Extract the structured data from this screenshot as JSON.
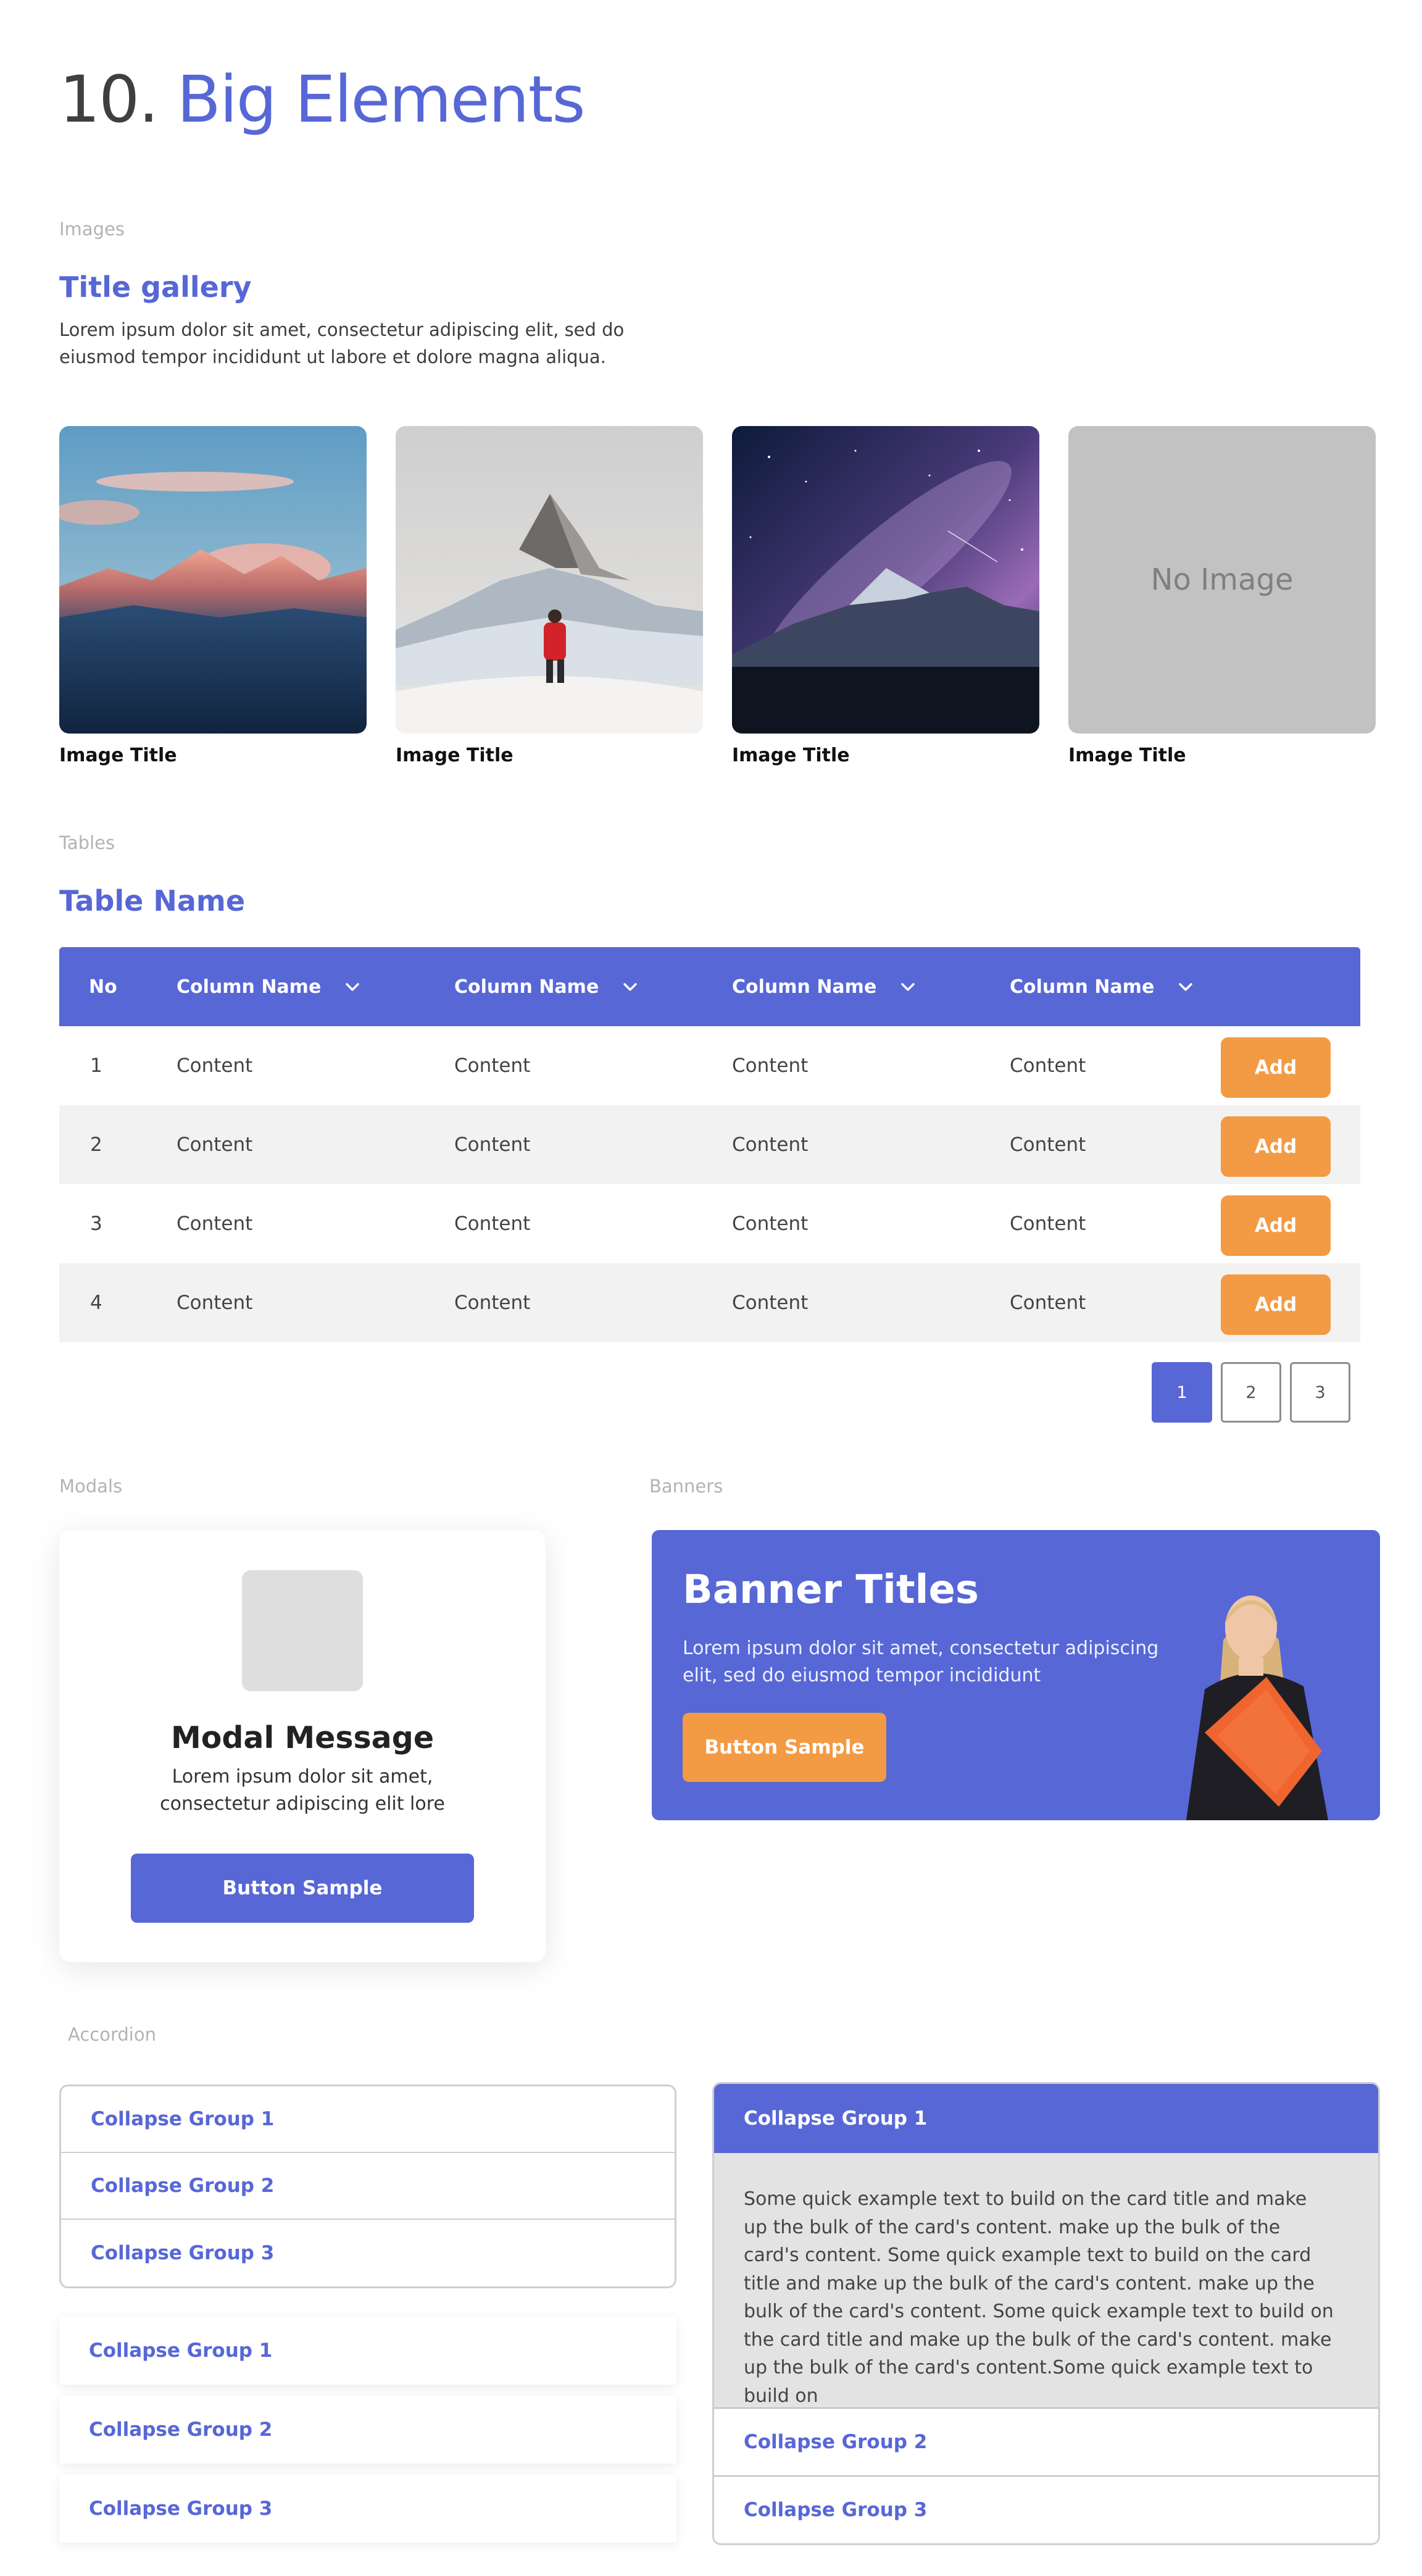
{
  "page": {
    "number": "10.",
    "title": "Big Elements"
  },
  "images": {
    "section_label": "Images",
    "title": "Title gallery",
    "description_line1": "Lorem ipsum dolor sit amet, consectetur adipiscing elit, sed do",
    "description_line2": "eiusmod tempor incididunt ut labore et dolore magna aliqua.",
    "items": [
      {
        "caption": "Image Title"
      },
      {
        "caption": "Image Title"
      },
      {
        "caption": "Image Title"
      },
      {
        "caption": "Image Title",
        "placeholder": "No Image"
      }
    ]
  },
  "tables": {
    "section_label": "Tables",
    "title": "Table Name",
    "headers": [
      "No",
      "Column Name",
      "Column Name",
      "Column Name",
      "Column Name"
    ],
    "rows": [
      {
        "no": "1",
        "cells": [
          "Content",
          "Content",
          "Content",
          "Content"
        ],
        "action": "Add"
      },
      {
        "no": "2",
        "cells": [
          "Content",
          "Content",
          "Content",
          "Content"
        ],
        "action": "Add"
      },
      {
        "no": "3",
        "cells": [
          "Content",
          "Content",
          "Content",
          "Content"
        ],
        "action": "Add"
      },
      {
        "no": "4",
        "cells": [
          "Content",
          "Content",
          "Content",
          "Content"
        ],
        "action": "Add"
      }
    ],
    "pagination": {
      "pages": [
        "1",
        "2",
        "3"
      ],
      "current": "1"
    }
  },
  "modals": {
    "section_label": "Modals",
    "title": "Modal Message",
    "text_line1": "Lorem ipsum dolor sit amet,",
    "text_line2": "consectetur adipiscing elit lore",
    "button": "Button Sample"
  },
  "banners": {
    "section_label": "Banners",
    "title": "Banner Titles",
    "text_line1": "Lorem ipsum dolor sit amet, consectetur adipiscing",
    "text_line2": "elit, sed do eiusmod tempor incididunt",
    "button": "Button Sample"
  },
  "accordion": {
    "section_label": "Accordion",
    "bordered": [
      "Collapse Group 1",
      "Collapse Group 2",
      "Collapse Group 3"
    ],
    "shadowed": [
      "Collapse Group 1",
      "Collapse Group 2",
      "Collapse Group 3"
    ],
    "expanded": {
      "open_title": "Collapse Group 1",
      "body": "Some quick example text to build on the card title and make up the bulk of the card's content.  make up the bulk of the card's content. Some quick example text to build on the card title and make up the bulk of the card's content.  make up the bulk of the card's content. Some quick example text to build on the card title and make up the bulk of the card's content.  make up the bulk of the card's content.Some quick example text to build on",
      "others": [
        "Collapse Group 2",
        "Collapse Group 3"
      ]
    }
  },
  "colors": {
    "primary": "#5767d6",
    "accent": "#f39a45",
    "row_alt": "#f2f2f2",
    "placeholder": "#c2c2c2"
  }
}
